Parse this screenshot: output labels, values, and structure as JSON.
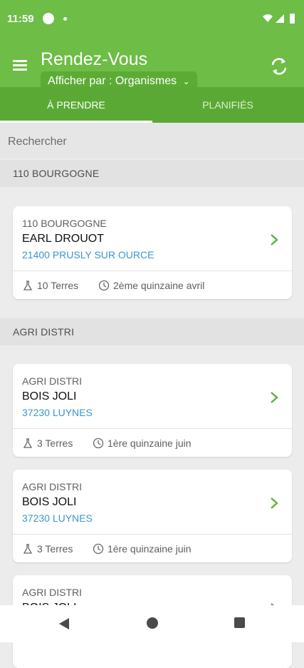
{
  "status_bar": {
    "time": "11:59"
  },
  "app_bar": {
    "title": "Rendez-Vous",
    "filter_label": "Afficher par : Organismes",
    "filter_chevron": "⌄"
  },
  "tabs": [
    {
      "label": "À PRENDRE",
      "active": true
    },
    {
      "label": "PLANIFIÉS",
      "active": false
    }
  ],
  "search": {
    "placeholder": "Rechercher"
  },
  "sections": [
    {
      "header": "110 BOURGOGNE",
      "cards": [
        {
          "org": "110 BOURGOGNE",
          "name": "EARL DROUOT",
          "city": "21400 PRUSLY SUR OURCE",
          "lands": "10 Terres",
          "period": "2ème quinzaine avril"
        }
      ]
    },
    {
      "header": "AGRI DISTRI",
      "cards": [
        {
          "org": "AGRI DISTRI",
          "name": "BOIS JOLI",
          "city": "37230 LUYNES",
          "lands": "3 Terres",
          "period": "1ère quinzaine juin"
        },
        {
          "org": "AGRI DISTRI",
          "name": "BOIS JOLI",
          "city": "37230 LUYNES",
          "lands": "3 Terres",
          "period": "1ère quinzaine juin"
        },
        {
          "org": "AGRI DISTRI",
          "name": "BOIS JOLI",
          "city": "",
          "lands": "",
          "period": ""
        }
      ]
    }
  ],
  "colors": {
    "primary": "#6dbd46",
    "primary_dark": "#5aa935",
    "link": "#3a97c9",
    "arrow": "#5cb33a"
  },
  "icons": [
    "menu-icon",
    "refresh-icon",
    "chevron-right-icon",
    "flask-icon",
    "clock-icon",
    "back-icon",
    "home-icon",
    "recents-icon"
  ]
}
